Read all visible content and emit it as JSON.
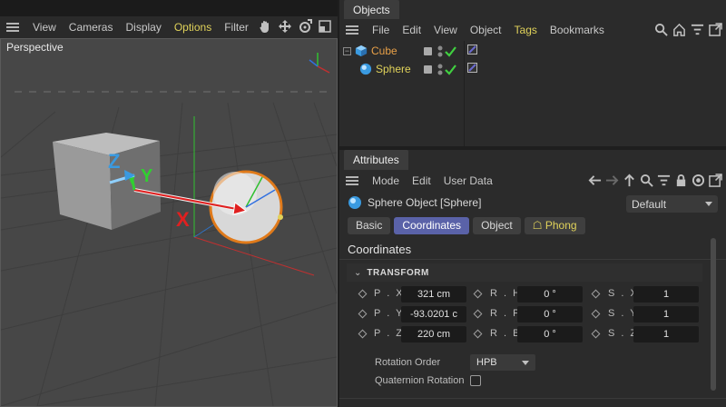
{
  "viewport": {
    "menus": [
      "View",
      "Cameras",
      "Display",
      "Options",
      "Filter",
      ">"
    ],
    "active_menu": "Options",
    "label": "Perspective",
    "axis_labels": {
      "x": "X",
      "y": "Y",
      "z": "Z"
    }
  },
  "objects_panel": {
    "tab": "Objects",
    "menus": [
      "File",
      "Edit",
      "View",
      "Object",
      "Tags",
      "Bookmarks"
    ],
    "items": [
      {
        "name": "Cube"
      },
      {
        "name": "Sphere"
      }
    ]
  },
  "attributes_panel": {
    "tab": "Attributes",
    "menus": [
      "Mode",
      "Edit",
      "User Data"
    ],
    "object_title": "Sphere Object [Sphere]",
    "preset": "Default",
    "tabs": [
      "Basic",
      "Coordinates",
      "Object",
      "Phong"
    ],
    "active_tab": "Coordinates",
    "section_title": "Coordinates",
    "group_title": "TRANSFORM",
    "fields": {
      "px": {
        "label": "P . X",
        "value": "321 cm"
      },
      "py": {
        "label": "P . Y",
        "value": "-93.0201 c"
      },
      "pz": {
        "label": "P . Z",
        "value": "220 cm"
      },
      "rh": {
        "label": "R . H",
        "value": "0 °"
      },
      "rp": {
        "label": "R . P",
        "value": "0 °"
      },
      "rb": {
        "label": "R . B",
        "value": "0 °"
      },
      "sx": {
        "label": "S . X",
        "value": "1"
      },
      "sy": {
        "label": "S . Y",
        "value": "1"
      },
      "sz": {
        "label": "S . Z",
        "value": "1"
      }
    },
    "rotation_order_label": "Rotation Order",
    "rotation_order_value": "HPB",
    "quaternion_label": "Quaternion Rotation"
  },
  "colors": {
    "accent_active_tab": "#5a62a8",
    "menu_active": "#e0d25a",
    "cube_name": "#e8a048",
    "axis_x": "#e02020",
    "axis_y": "#30d030",
    "axis_z": "#3a9ae0",
    "selection_orange": "#e07a1a"
  }
}
